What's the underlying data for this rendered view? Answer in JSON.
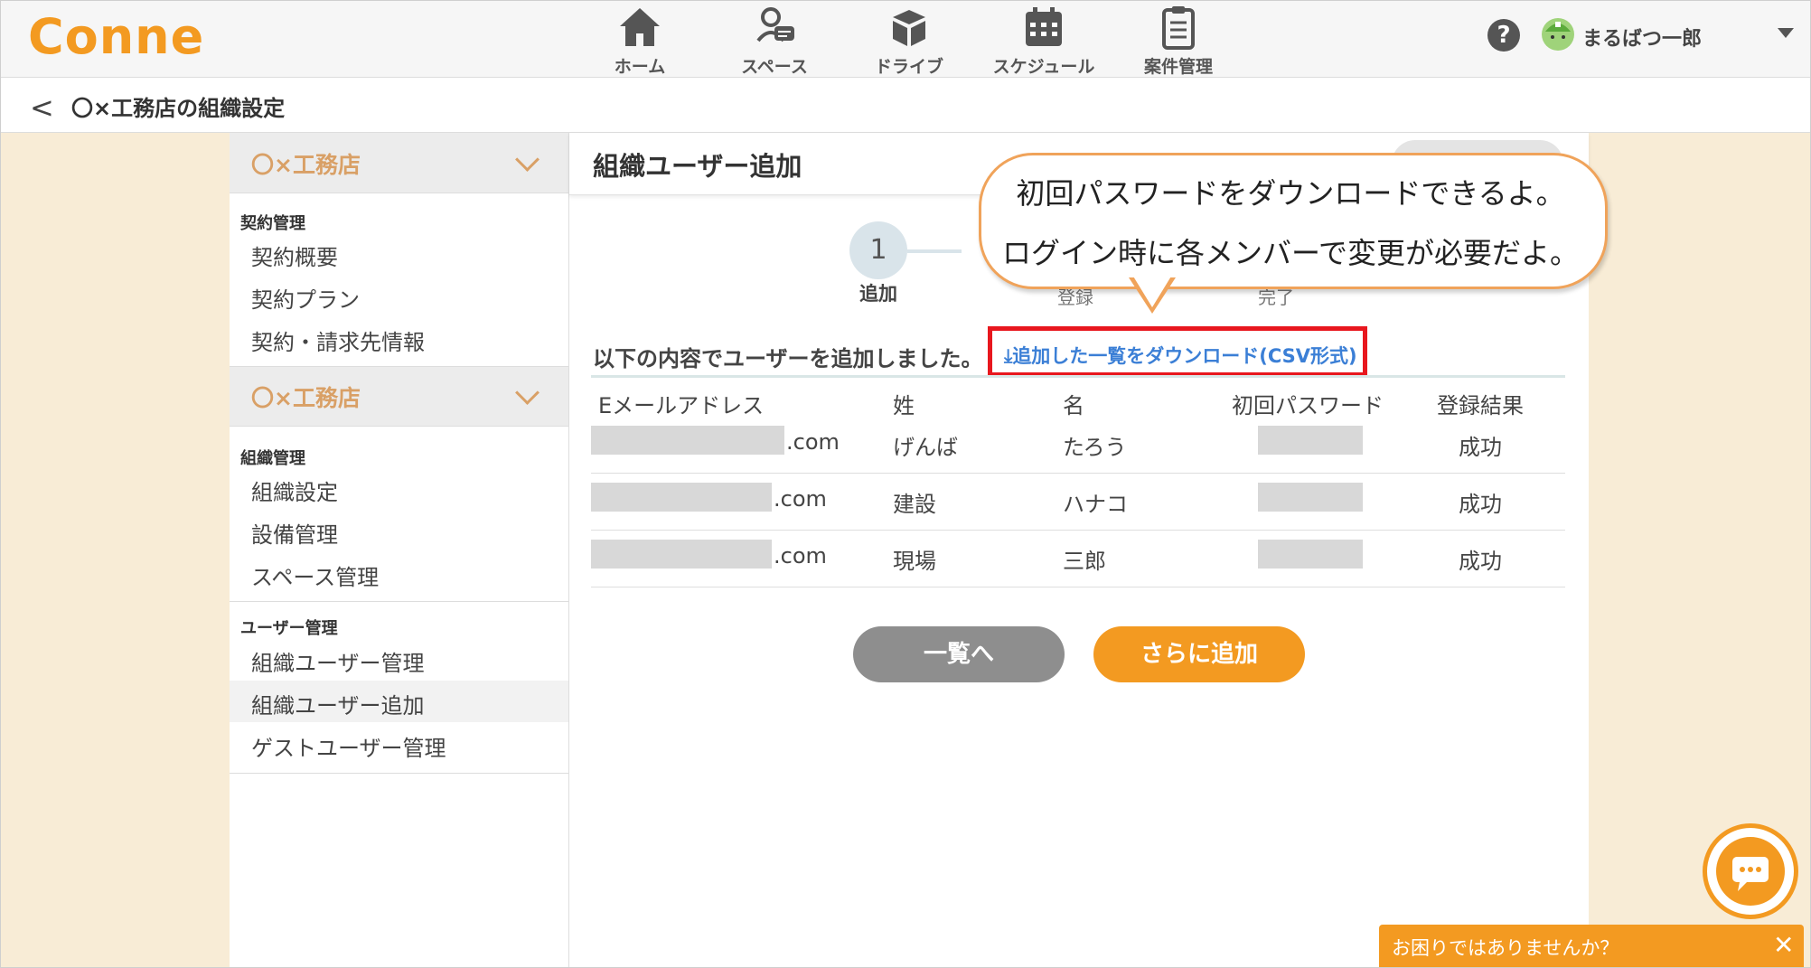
{
  "app": {
    "logo": "Conne"
  },
  "nav": [
    {
      "label": "ホーム",
      "icon": "home-icon"
    },
    {
      "label": "スペース",
      "icon": "space-chat-icon"
    },
    {
      "label": "ドライブ",
      "icon": "drive-box-icon"
    },
    {
      "label": "スケジュール",
      "icon": "calendar-icon"
    },
    {
      "label": "案件管理",
      "icon": "clipboard-icon"
    }
  ],
  "user": {
    "help": "?",
    "name": "まるばつ一郎"
  },
  "subheader": {
    "back": "<",
    "title": "〇×工務店の組織設定"
  },
  "sidebar": {
    "org1": "〇×工務店",
    "contract_label": "契約管理",
    "contract_items": [
      "契約概要",
      "契約プラン",
      "契約・請求先情報"
    ],
    "org2": "〇×工務店",
    "org_label": "組織管理",
    "org_items": [
      "組織設定",
      "設備管理",
      "スペース管理"
    ],
    "user_label": "ユーザー管理",
    "user_items": [
      "組織ユーザー管理",
      "組織ユーザー追加",
      "ゲストユーザー管理"
    ]
  },
  "main": {
    "title": "組織ユーザー追加",
    "step_number": "1",
    "step_label": "追加",
    "ghost_step2": "登録",
    "ghost_step3": "完了",
    "done_text": "以下の内容でユーザーを追加しました。",
    "csv_link": "⤓追加した一覧をダウンロード(CSV形式)",
    "columns": [
      "Eメールアドレス",
      "姓",
      "名",
      "初回パスワード",
      "登録結果"
    ],
    "rows": [
      {
        "email_suffix": ".com",
        "last": "げんば",
        "first": "たろう",
        "result": "成功"
      },
      {
        "email_suffix": ".com",
        "last": "建設",
        "first": "ハナコ",
        "result": "成功"
      },
      {
        "email_suffix": ".com",
        "last": "現場",
        "first": "三郎",
        "result": "成功"
      }
    ],
    "btn_list": "一覧へ",
    "btn_add": "さらに追加"
  },
  "bubble": {
    "line1": "初回パスワードをダウンロードできるよ。",
    "line2": "ログイン時に各メンバーで変更が必要だよ。"
  },
  "chat": {
    "bar_text": "お困りではありませんか？",
    "close": "✕"
  },
  "colors": {
    "accent": "#f39a21",
    "link": "#3b7fd6",
    "highlight": "#e8171e",
    "background": "#f8ecd6"
  }
}
